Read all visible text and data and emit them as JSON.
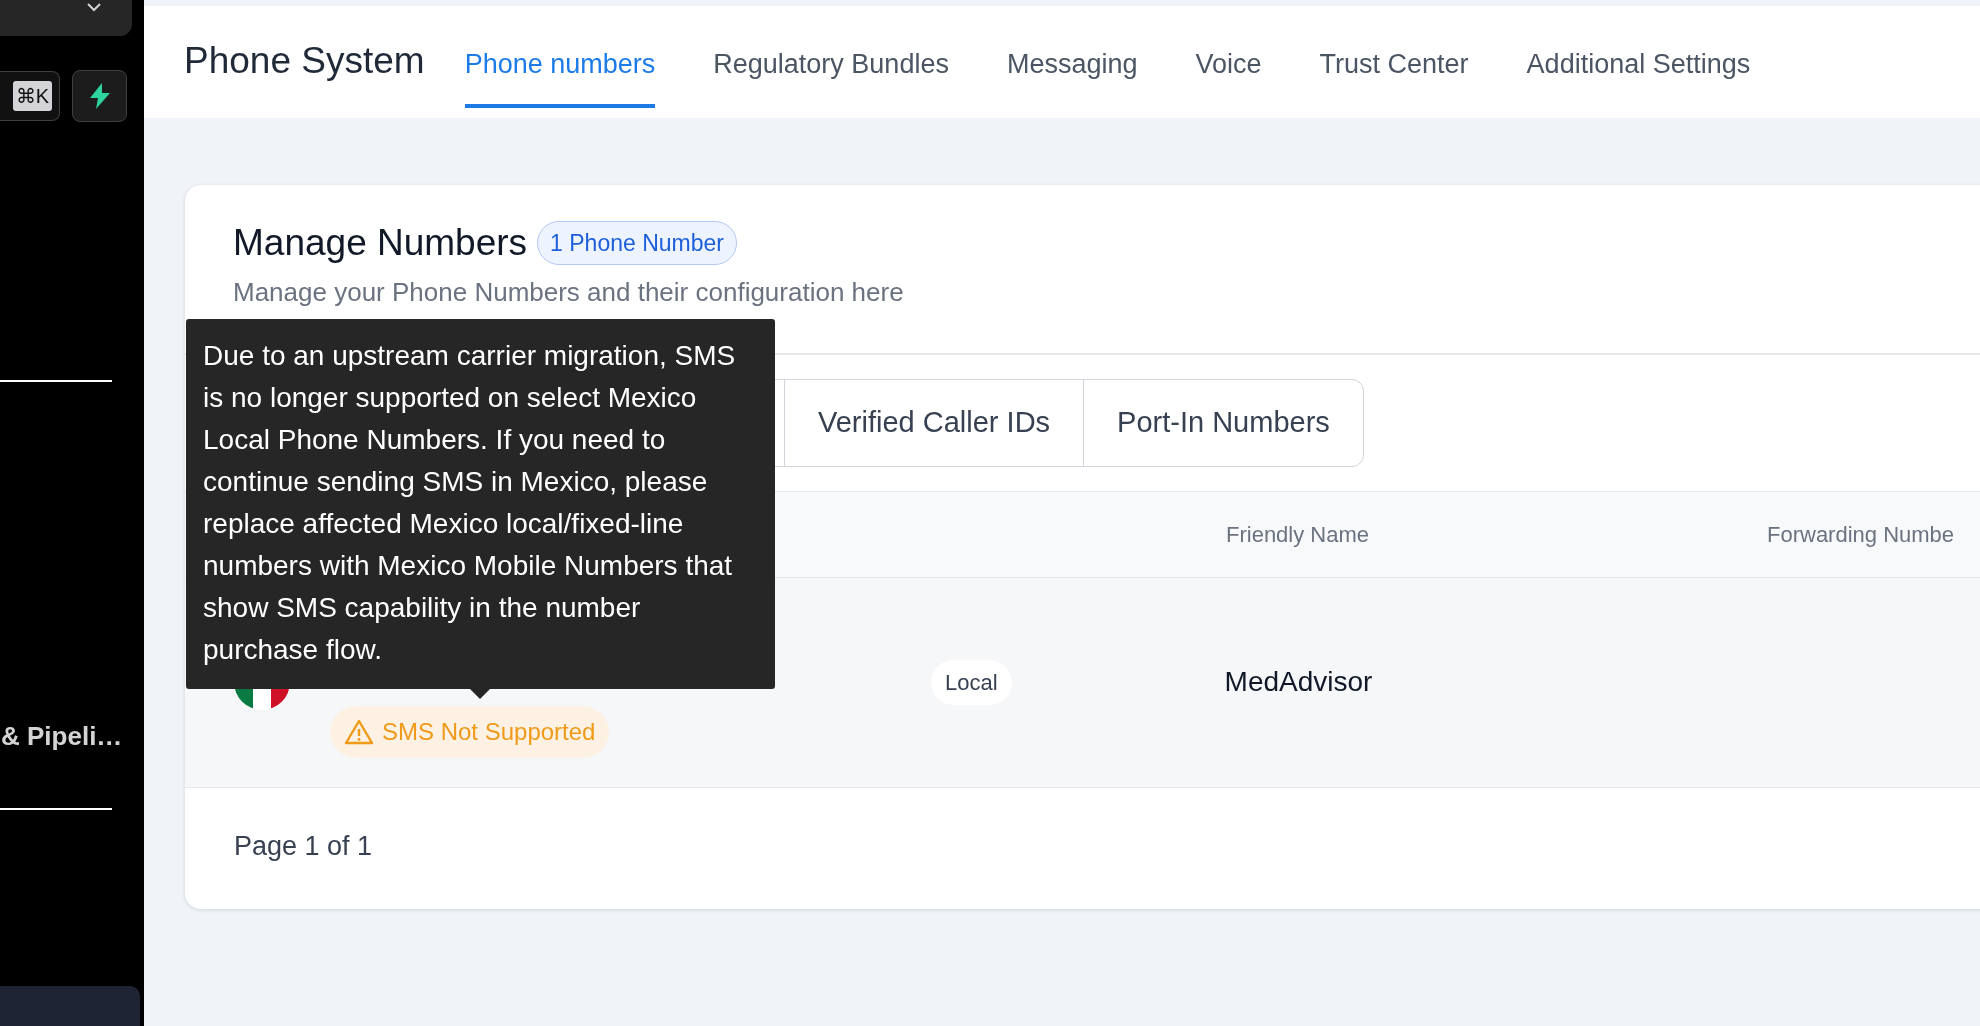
{
  "sidebar": {
    "shortcut": "⌘K",
    "items": [
      {
        "label": "& Pipeli…"
      }
    ]
  },
  "header": {
    "title": "Phone System",
    "tabs": [
      {
        "label": "Phone numbers",
        "selected": true
      },
      {
        "label": "Regulatory Bundles",
        "selected": false
      },
      {
        "label": "Messaging",
        "selected": false
      },
      {
        "label": "Voice",
        "selected": false
      },
      {
        "label": "Trust Center",
        "selected": false
      },
      {
        "label": "Additional Settings",
        "selected": false
      }
    ]
  },
  "card": {
    "title": "Manage Numbers",
    "badge": "1 Phone Number",
    "subtitle": "Manage your Phone Numbers and their configuration here",
    "segments": [
      {
        "label": "Verified Caller IDs",
        "selected": false
      },
      {
        "label": "Port-In Numbers",
        "selected": false
      }
    ],
    "tooltip": "Due to an upstream carrier migration, SMS is no longer supported on select Mexico Local Phone Numbers. If you need to continue sending SMS in Mexico, please replace affected Mexico local/fixed-line numbers with Mexico Mobile Numbers that show SMS capability in the number purchase flow."
  },
  "table": {
    "columns": [
      "Friendly Name",
      "Forwarding Numbe"
    ],
    "rows": [
      {
        "warning": "SMS Not Supported",
        "type": "Local",
        "friendly_name": "MedAdvisor"
      }
    ]
  },
  "pagination": "Page 1 of 1"
}
